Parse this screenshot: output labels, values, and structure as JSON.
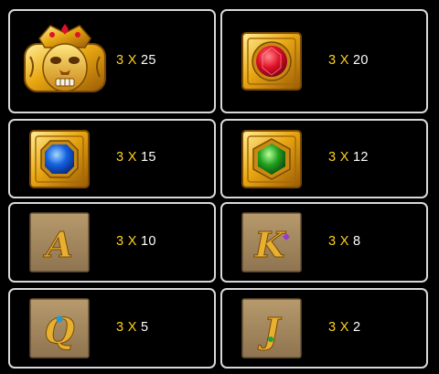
{
  "paytable": [
    {
      "symbol": "golden-lion-mask-icon",
      "count": "3",
      "x": "X",
      "payout": "25"
    },
    {
      "symbol": "red-gem-tile-icon",
      "count": "3",
      "x": "X",
      "payout": "20"
    },
    {
      "symbol": "blue-gem-tile-icon",
      "count": "3",
      "x": "X",
      "payout": "15"
    },
    {
      "symbol": "green-gem-tile-icon",
      "count": "3",
      "x": "X",
      "payout": "12"
    },
    {
      "symbol": "letter-a-tile-icon",
      "count": "3",
      "x": "X",
      "payout": "10",
      "letter": "A"
    },
    {
      "symbol": "letter-k-tile-icon",
      "count": "3",
      "x": "X",
      "payout": "8",
      "letter": "K"
    },
    {
      "symbol": "letter-q-tile-icon",
      "count": "3",
      "x": "X",
      "payout": "5",
      "letter": "Q"
    },
    {
      "symbol": "letter-j-tile-icon",
      "count": "3",
      "x": "X",
      "payout": "2",
      "letter": "J"
    }
  ],
  "colors": {
    "border": "#d9d9d9",
    "accent": "#ffd21a",
    "text": "#ffffff",
    "background": "#000000"
  }
}
